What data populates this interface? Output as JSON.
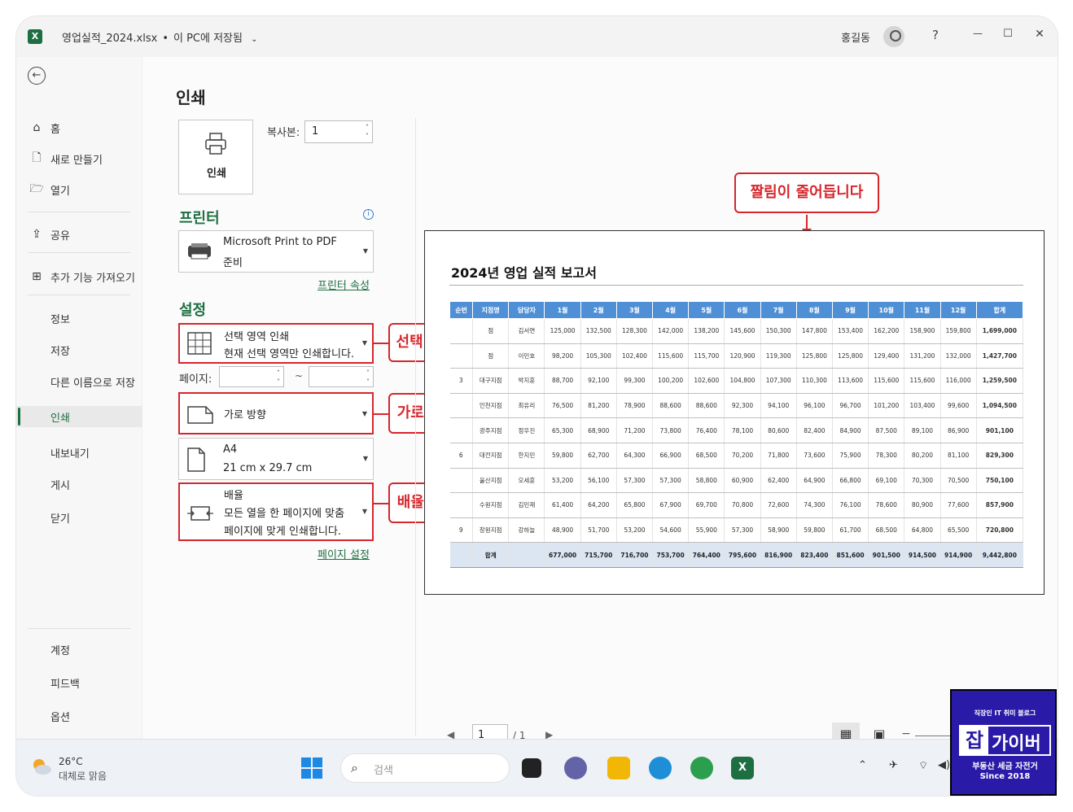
{
  "titlebar": {
    "filename": "영업실적_2024.xlsx",
    "separator": "•",
    "save_status": "이 PC에 저장됨",
    "user_name": "홍길동",
    "help": "?",
    "minimize": "—",
    "maximize": "☐",
    "close": "✕"
  },
  "nav": {
    "items": [
      {
        "label": "홈",
        "icon": "home-icon"
      },
      {
        "label": "새로 만들기",
        "icon": "new-file-icon"
      },
      {
        "label": "열기",
        "icon": "folder-icon"
      },
      {
        "label": "공유",
        "icon": "share-icon"
      },
      {
        "label": "추가 기능 가져오기",
        "icon": "addins-icon"
      },
      {
        "label": "정보"
      },
      {
        "label": "저장"
      },
      {
        "label": "다른 이름으로 저장"
      },
      {
        "label": "인쇄",
        "active": true
      },
      {
        "label": "내보내기"
      },
      {
        "label": "게시"
      },
      {
        "label": "닫기"
      },
      {
        "label": "계정"
      },
      {
        "label": "피드백"
      },
      {
        "label": "옵션"
      }
    ]
  },
  "print": {
    "title": "인쇄",
    "button_label": "인쇄",
    "copies_label": "복사본:",
    "copies_value": "1",
    "printer_heading": "프린터",
    "printer_name": "Microsoft Print to PDF",
    "printer_status": "준비",
    "printer_props_link": "프린터 속성",
    "settings_heading": "설정",
    "scope_title": "선택 영역 인쇄",
    "scope_desc": "현재 선택 영역만 인쇄합니다.",
    "pages_label": "페이지:",
    "pages_sep": "~",
    "orientation": "가로 방향",
    "paper_name": "A4",
    "paper_size": "21 cm x 29.7 cm",
    "scaling_title": "배율",
    "scaling_line1": "모든 열을 한 페이지에 맞춤",
    "scaling_line2": "페이지에 맞게 인쇄합니다.",
    "page_setup_link": "페이지 설정"
  },
  "callouts": {
    "truncation": "짤림이 줄어듭니다",
    "selection": "선택 영역 인쇄",
    "landscape": "가로 방향",
    "fit": "배율 맞춤"
  },
  "colors": {
    "accent": "#1d6f42",
    "callout_red": "#d6262c",
    "table_header": "#4f8fd6",
    "table_total": "#dce6f2"
  },
  "report": {
    "title": "2024년 영업 실적 보고서",
    "headers": [
      "순번",
      "지점명",
      "담당자",
      "1월",
      "2월",
      "3월",
      "4월",
      "5월",
      "6월",
      "7월",
      "8월",
      "9월",
      "10월",
      "11월",
      "12월",
      "합계"
    ],
    "rows": [
      [
        "",
        "점",
        "김서연",
        "125,000",
        "132,500",
        "128,300",
        "142,000",
        "138,200",
        "145,600",
        "150,300",
        "147,800",
        "153,400",
        "162,200",
        "158,900",
        "159,800",
        "1,699,000"
      ],
      [
        "",
        "점",
        "이민호",
        "98,200",
        "105,300",
        "102,400",
        "115,600",
        "115,700",
        "120,900",
        "119,300",
        "125,800",
        "125,800",
        "129,400",
        "131,200",
        "132,000",
        "1,427,700"
      ],
      [
        "3",
        "대구지점",
        "박지훈",
        "88,700",
        "92,100",
        "99,300",
        "100,200",
        "102,600",
        "104,800",
        "107,300",
        "110,300",
        "113,600",
        "115,600",
        "115,600",
        "116,000",
        "1,259,500"
      ],
      [
        "",
        "인천지점",
        "최유리",
        "76,500",
        "81,200",
        "78,900",
        "88,600",
        "88,600",
        "92,300",
        "94,100",
        "96,100",
        "96,700",
        "101,200",
        "103,400",
        "99,600",
        "1,094,500"
      ],
      [
        "",
        "광주지점",
        "정우진",
        "65,300",
        "68,900",
        "71,200",
        "73,800",
        "76,400",
        "78,100",
        "80,600",
        "82,400",
        "84,900",
        "87,500",
        "89,100",
        "86,900",
        "901,100"
      ],
      [
        "6",
        "대전지점",
        "한지민",
        "59,800",
        "62,700",
        "64,300",
        "66,900",
        "68,500",
        "70,200",
        "71,800",
        "73,600",
        "75,900",
        "78,300",
        "80,200",
        "81,100",
        "829,300"
      ],
      [
        "",
        "울산지점",
        "오세훈",
        "53,200",
        "56,100",
        "57,300",
        "57,300",
        "58,800",
        "60,900",
        "62,400",
        "64,900",
        "66,800",
        "69,100",
        "70,300",
        "70,500",
        "750,100"
      ],
      [
        "",
        "수원지점",
        "김민재",
        "61,400",
        "64,200",
        "65,800",
        "67,900",
        "69,700",
        "70,800",
        "72,600",
        "74,300",
        "76,100",
        "78,600",
        "80,900",
        "77,600",
        "857,900"
      ],
      [
        "9",
        "창원지점",
        "강하늘",
        "48,900",
        "51,700",
        "53,200",
        "54,600",
        "55,900",
        "57,300",
        "58,900",
        "59,800",
        "61,700",
        "68,500",
        "64,800",
        "65,500",
        "720,800"
      ]
    ],
    "totals": [
      "",
      "합계",
      "",
      "677,000",
      "715,700",
      "716,700",
      "753,700",
      "764,400",
      "795,600",
      "816,900",
      "823,400",
      "851,600",
      "901,500",
      "914,500",
      "914,900",
      "9,442,800"
    ]
  },
  "page_nav": {
    "prev": "◀",
    "current": "1",
    "of": "/ 1",
    "next": "▶"
  },
  "taskbar": {
    "temperature": "26°C",
    "weather": "대체로 맑음",
    "search_placeholder": "검색"
  },
  "badge": {
    "line1": "직장인 IT 취미 블로그",
    "logo_char": "잡",
    "logo_text": "가이버",
    "line3": "부동산 세금 자전거",
    "line4": "Since 2018"
  }
}
